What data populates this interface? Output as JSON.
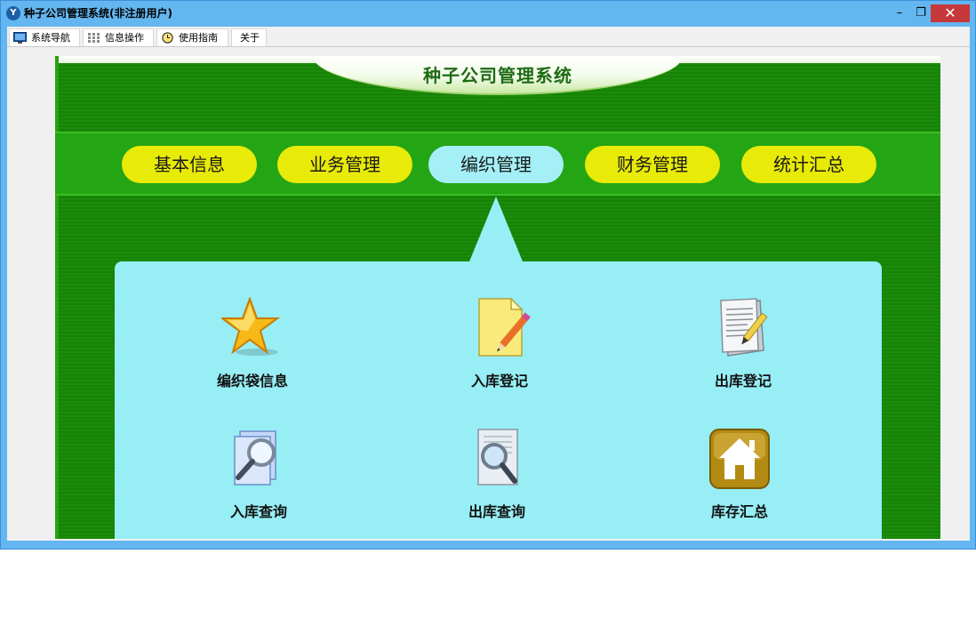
{
  "window": {
    "title": "种子公司管理系统(非注册用户)",
    "controls": {
      "minimize": "–",
      "restore": "❐",
      "close": "✕"
    }
  },
  "tabs": [
    {
      "label": "系统导航",
      "icon": "monitor-icon"
    },
    {
      "label": "信息操作",
      "icon": "grid-icon"
    },
    {
      "label": "使用指南",
      "icon": "clock-icon"
    },
    {
      "label": "关于"
    }
  ],
  "header": {
    "title": "种子公司管理系统"
  },
  "menu": {
    "items": [
      "基本信息",
      "业务管理",
      "编织管理",
      "财务管理",
      "统计汇总"
    ],
    "active": "编织管理"
  },
  "panel": {
    "items": [
      {
        "label": "编织袋信息",
        "icon": "star-icon"
      },
      {
        "label": "入库登记",
        "icon": "note-pencil-icon"
      },
      {
        "label": "出库登记",
        "icon": "document-pen-icon"
      },
      {
        "label": "入库查询",
        "icon": "magnifier-files-icon"
      },
      {
        "label": "出库查询",
        "icon": "magnifier-document-icon"
      },
      {
        "label": "库存汇总",
        "icon": "home-icon"
      }
    ]
  },
  "colors": {
    "titlebar": "#63b6ef",
    "board_green": "#1c8b0a",
    "menu_green": "#24a514",
    "pill_yellow": "#e8ea07",
    "pill_active": "#a4f0f6",
    "panel_cyan": "#97eef5",
    "close_red": "#c7383a"
  }
}
